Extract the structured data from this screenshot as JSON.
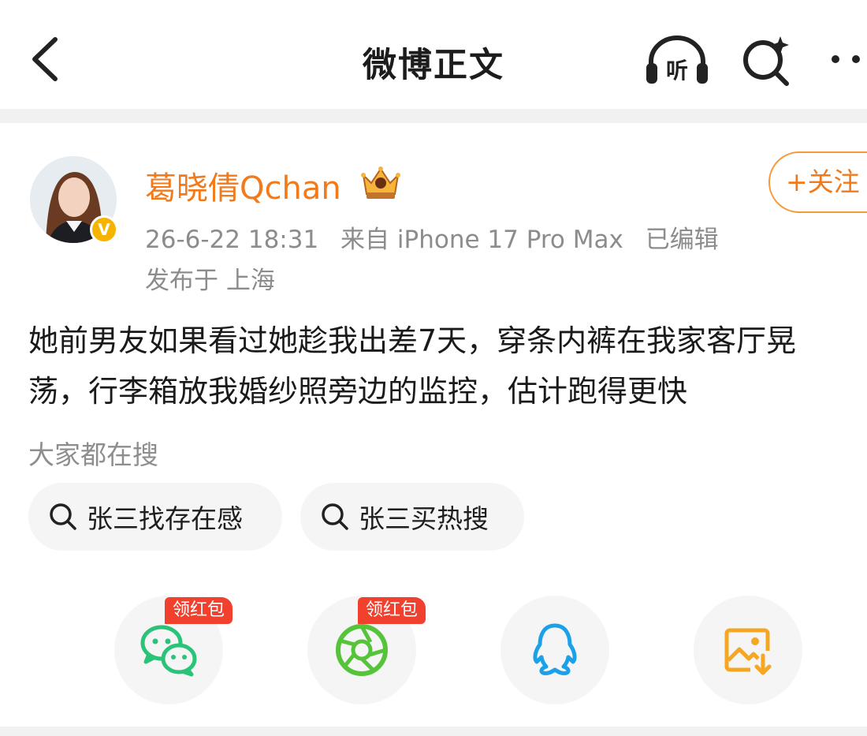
{
  "header": {
    "title": "微博正文",
    "listen_label": "听",
    "icons": [
      "back-icon",
      "listen-icon",
      "search-ai-icon",
      "more-icon"
    ]
  },
  "post": {
    "author": {
      "name": "葛晓倩Qchan",
      "verified_mark": "V",
      "name_color": "#f27a1a"
    },
    "meta": {
      "time": "26-6-22 18:31",
      "source": "来自 iPhone 17 Pro Max",
      "edited": "已编辑",
      "location": "发布于 上海"
    },
    "follow_label": "+关注",
    "text_line_1": "她前男友如果看过她趁我出差7天，穿条内裤在我家客厅晃",
    "text_line_2": "荡，行李箱放我婚纱照旁边的监控，估计跑得更快"
  },
  "hot_search": {
    "label": "大家都在搜",
    "chips": [
      {
        "label": "张三找存在感"
      },
      {
        "label": "张三买热搜"
      }
    ]
  },
  "share": {
    "items": [
      {
        "name": "wechat",
        "badge": "领红包",
        "color": "#2bc37a"
      },
      {
        "name": "moments",
        "badge": "领红包",
        "color": "#56c43a"
      },
      {
        "name": "qq",
        "color": "#1ba1e8"
      },
      {
        "name": "save-image",
        "color": "#f5a623"
      }
    ]
  }
}
